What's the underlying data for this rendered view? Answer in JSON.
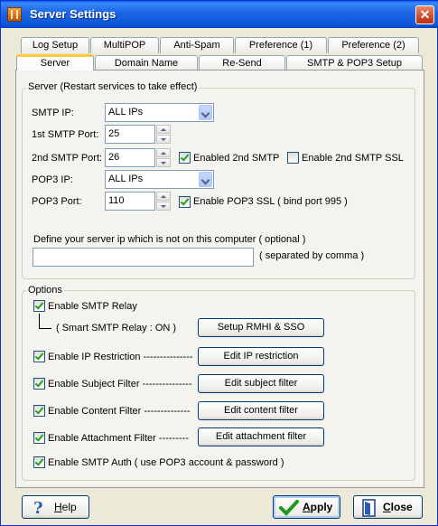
{
  "window": {
    "title": "Server Settings",
    "close_glyph": "✕"
  },
  "tabs_row1": [
    {
      "label": "Log Setup"
    },
    {
      "label": "MultiPOP"
    },
    {
      "label": "Anti-Spam"
    },
    {
      "label": "Preference (1)"
    },
    {
      "label": "Preference (2)"
    }
  ],
  "tabs_row2": [
    {
      "label": "Server",
      "active": true
    },
    {
      "label": "Domain Name"
    },
    {
      "label": "Re-Send"
    },
    {
      "label": "SMTP & POP3 Setup"
    }
  ],
  "server_group": {
    "title": "Server (Restart services to take effect)",
    "smtp_ip": {
      "label": "SMTP IP:",
      "value": "ALL IPs"
    },
    "smtp_port1": {
      "label": "1st  SMTP Port:",
      "value": "25"
    },
    "smtp_port2": {
      "label": "2nd SMTP Port:",
      "value": "26"
    },
    "enabled_2nd_smtp": {
      "label": "Enabled 2nd SMTP",
      "checked": true
    },
    "enable_2nd_smtp_ssl": {
      "label": "Enable 2nd SMTP SSL",
      "checked": false
    },
    "pop3_ip": {
      "label": "POP3 IP:",
      "value": "ALL IPs"
    },
    "pop3_port": {
      "label": "POP3 Port:",
      "value": "110"
    },
    "enable_pop3_ssl": {
      "label": "Enable POP3 SSL ( bind port 995 )",
      "checked": true
    },
    "define_ip": {
      "label": "Define your server ip which is not on this computer ( optional )",
      "value": "",
      "hint": "( separated by comma )"
    }
  },
  "options_group": {
    "title": "Options",
    "smtp_relay": {
      "label": "Enable SMTP Relay",
      "checked": true
    },
    "smart_relay": {
      "label": "( Smart SMTP Relay : ON )",
      "button": "Setup RMHI & SSO"
    },
    "ip_restriction": {
      "label": "Enable IP Restriction ---------------",
      "checked": true,
      "button": "Edit IP restriction"
    },
    "subject_filter": {
      "label": "Enable Subject Filter ---------------",
      "checked": true,
      "button": "Edit subject filter"
    },
    "content_filter": {
      "label": "Enable Content Filter --------------",
      "checked": true,
      "button": "Edit content filter"
    },
    "attachment_filter": {
      "label": "Enable Attachment Filter  ---------",
      "checked": true,
      "button": "Edit attachment filter"
    },
    "smtp_auth": {
      "label": "Enable SMTP Auth ( use POP3 account & password )",
      "checked": true
    }
  },
  "footer": {
    "help": {
      "prefix": "",
      "accel": "H",
      "rest": "elp"
    },
    "apply": {
      "accel": "A",
      "rest": "pply"
    },
    "close": {
      "accel": "C",
      "rest": "lose"
    }
  },
  "colors": {
    "titlebar": "#0b56d8",
    "window_bg": "#ece9d8",
    "panel_bg": "#f4f3ee",
    "check": "#21a121",
    "tab_hot": "#ffc83c"
  },
  "icons": [
    "app-icon",
    "close-icon",
    "dropdown-arrow-icon",
    "spin-up-icon",
    "spin-down-icon",
    "help-icon",
    "apply-check-icon",
    "close-door-icon"
  ]
}
